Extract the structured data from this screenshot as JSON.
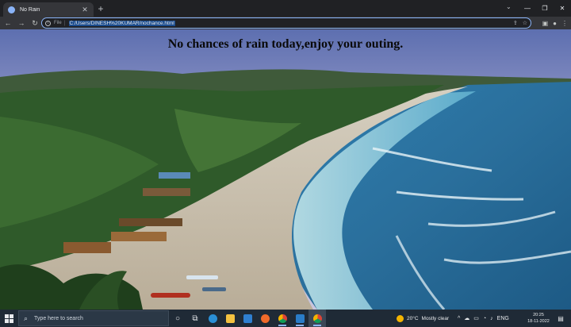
{
  "browser": {
    "tab_title": "No Rain",
    "new_tab_label": "+",
    "address_scheme_label": "File",
    "address_url": "C:/Users/DINESH%20KUMAR/nochance.html"
  },
  "page": {
    "heading": "No chances of rain today,enjoy your outing."
  },
  "taskbar": {
    "search_placeholder": "Type here to search",
    "weather_temp": "20°C",
    "weather_condition": "Mostly clear",
    "language": "ENG",
    "time": "20:25",
    "date": "18-11-2022"
  },
  "icons": {
    "tab_favicon": "globe-icon",
    "taskbar_apps": [
      "cortana-icon",
      "task-view-icon",
      "edge-icon",
      "file-explorer-icon",
      "mail-icon",
      "firefox-icon",
      "chrome-icon",
      "vscode-icon",
      "chrome-icon"
    ]
  }
}
